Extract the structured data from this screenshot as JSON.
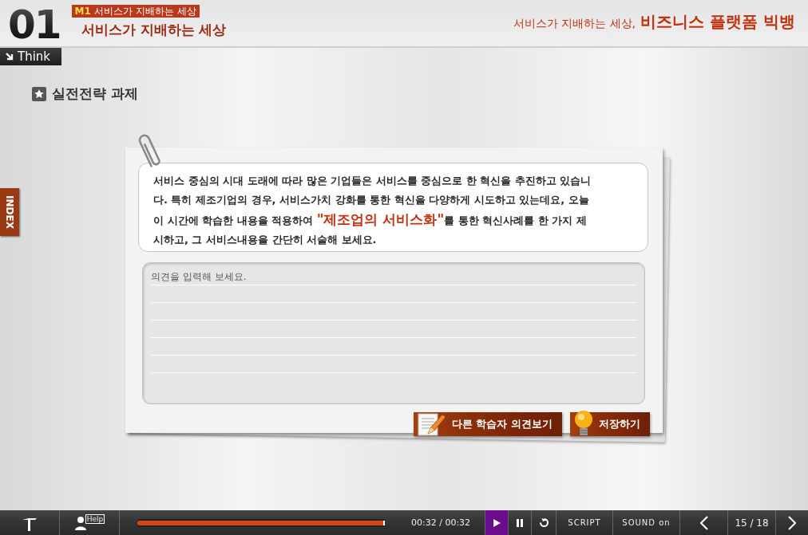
{
  "header": {
    "number": "01",
    "module_badge": {
      "code": "M1",
      "title": "서비스가 지배하는 세상"
    },
    "title": "서비스가 지배하는 세상",
    "course_title": {
      "lead": "서비스가 지배하는 세상,",
      "main": "비즈니스 플랫폼 빅뱅"
    },
    "section_tab": "Think"
  },
  "index_tab": "INDEX",
  "section_heading": "실전전략 과제",
  "task": {
    "question": "서비스 중심의 시대 도래에 따라 많은 기업들은 서비스를 중심으로 한 혁신을 추진하고 있습니다. 특히 제조기업의 경우, 서비스가치 강화를 통한 혁신을 다양하게 시도하고 있는데요, 오늘 이 시간에 학습한 내용을 적용하여 **\"제조업의 서비스화\"**를 통한 혁신사례를 한 가지 제시하고, 그 서비스내용을 간단히 서술해 보세요.",
    "answer": {
      "placeholder": "의견을 입력해 보세요."
    },
    "buttons": [
      {
        "kind": "others",
        "label": "다른 학습자 의견보기"
      },
      {
        "kind": "save",
        "label": "저장하기"
      }
    ]
  },
  "player": {
    "help_label": "Help",
    "progress": {
      "level": 1
    },
    "time": "00:32 / 00:32",
    "controls": [
      {
        "kind": "play",
        "selected": true
      },
      {
        "kind": "pause",
        "selected": false
      },
      {
        "kind": "replay",
        "selected": false
      }
    ],
    "script_label": "SCRIPT",
    "sound_label": "SOUND on",
    "page": "15 / 18"
  }
}
